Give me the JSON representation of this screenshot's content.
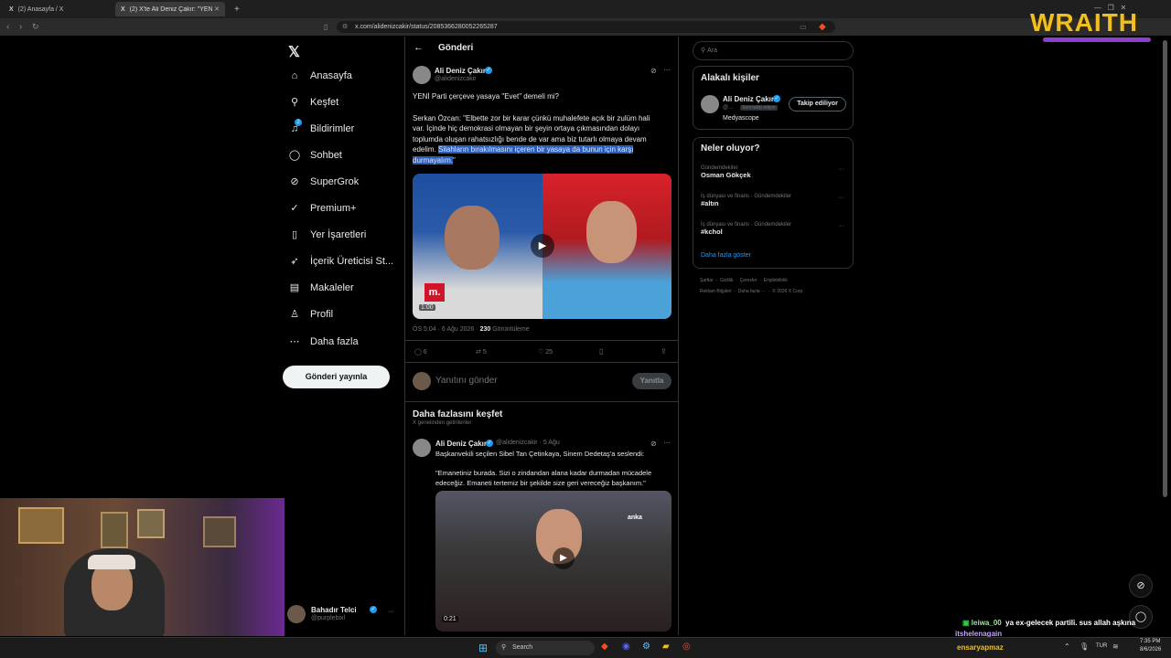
{
  "browser": {
    "tabs": [
      {
        "label": "(2) Anasayfa / X"
      },
      {
        "label": "(2) X'te Ali Deniz Çakır: \"YENİ Pa..."
      }
    ],
    "url": "x.com/alidenizcakir/status/2085366280052265287",
    "new_tab": "+"
  },
  "overlay": {
    "brand": "WRAITH"
  },
  "sidebar": {
    "items": [
      {
        "label": "Anasayfa",
        "icon": "home-icon"
      },
      {
        "label": "Keşfet",
        "icon": "search-icon"
      },
      {
        "label": "Bildirimler",
        "icon": "bell-icon",
        "badge": "2"
      },
      {
        "label": "Sohbet",
        "icon": "chat-icon"
      },
      {
        "label": "SuperGrok",
        "icon": "grok-icon"
      },
      {
        "label": "Premium+",
        "icon": "premium-icon"
      },
      {
        "label": "Yer İşaretleri",
        "icon": "bookmark-icon"
      },
      {
        "label": "İçerik Üreticisi St...",
        "icon": "rocket-icon"
      },
      {
        "label": "Makaleler",
        "icon": "article-icon"
      },
      {
        "label": "Profil",
        "icon": "user-icon"
      },
      {
        "label": "Daha fazla",
        "icon": "more-icon"
      }
    ],
    "post_button": "Gönderi yayınla",
    "account": {
      "name": "Bahadır Telci",
      "handle": "@purplebixl"
    }
  },
  "main": {
    "header_title": "Gönderi",
    "post": {
      "author_name": "Ali Deniz Çakır",
      "author_handle": "@alidenizcakir",
      "line1": "YENİ Parti çerçeve yasaya \"Evet\" demeli mi?",
      "para_lines": [
        "Serkan Özcan: \"Elbette zor bir karar çünkü muhalefete açık bir zulüm hali",
        "var. İçinde hiç demokrasi olmayan bir şeyin ortaya çıkmasından dolayı",
        "toplumda oluşan rahatsızlığı bende de var ama biz tutarlı olmaya devam"
      ],
      "line_pre": "edelim. ",
      "highlight1": "Silahların bırakılmasını içeren bir yasaya da bunun için karşı",
      "highlight2": "durmayalım.",
      "line_end": "\"",
      "video_duration": "1:00",
      "video_logo": "m.",
      "meta_time": "ÖS 5:04 · 6 Ağu 2026 · ",
      "meta_views": "230",
      "meta_views_label": " Görüntüleme",
      "replies": "6",
      "reposts": "5",
      "likes": "25"
    },
    "reply_placeholder": "Yanıtını gönder",
    "reply_button": "Yanıtla",
    "discover_title": "Daha fazlasını keşfet",
    "discover_sub": "X genelinden getirilenler",
    "post2": {
      "author_name": "Ali Deniz Çakır",
      "author_handle": "@alidenizcakir · 5 Ağu",
      "line1": "Başkanvekili seçilen Sibel Tan Çetinkaya, Sinem Dedetaş'a seslendi:",
      "quote1": "\"Emanetiniz burada. Sizi o zindandan alana kadar durmadan mücadele",
      "quote2": "edeceğiz. Emaneti tertemiz bir şekilde size geri vereceğiz başkanım.\"",
      "video_duration": "0:21",
      "video_tag": "anka"
    }
  },
  "right": {
    "search_placeholder": "Ara",
    "related_title": "Alakalı kişiler",
    "person": {
      "name": "Ali Deniz Çakır",
      "handle": "@...",
      "badge": "Seni takip ediyor",
      "bio": "Medyascope",
      "follow": "Takip ediliyor"
    },
    "trends_title": "Neler oluyor?",
    "trends": [
      {
        "context": "Gündemdekiler",
        "name": "Osman Gökçek"
      },
      {
        "context": "İş dünyası ve finans · Gündemdekiler",
        "name": "#altın"
      },
      {
        "context": "İş dünyası ve finans · Gündemdekiler",
        "name": "#kchol"
      }
    ],
    "show_more": "Daha fazla göster",
    "footer1": "Şartlar  ·  Gizlilik  ·  Çerezler  ·  Erişilebilirlik",
    "footer2": "Reklam Bilgileri  ·  Daha fazla ···  ·  © 2026 X Corp."
  },
  "stream": {
    "chat1_user": "leiwa_00",
    "chat1_msg": "ya ex-gelecek partili. sus allah aşkına",
    "chat2_user": "itshelenagain",
    "chat3_user": "ensaryapmaz"
  },
  "taskbar": {
    "search": "Search",
    "lang": "TUR",
    "time": "7:35 PM",
    "date": "8/6/2026"
  },
  "colors": {
    "accent": "#1d9bf0",
    "highlight": "#2a5db8",
    "brand": "#f0c020"
  }
}
